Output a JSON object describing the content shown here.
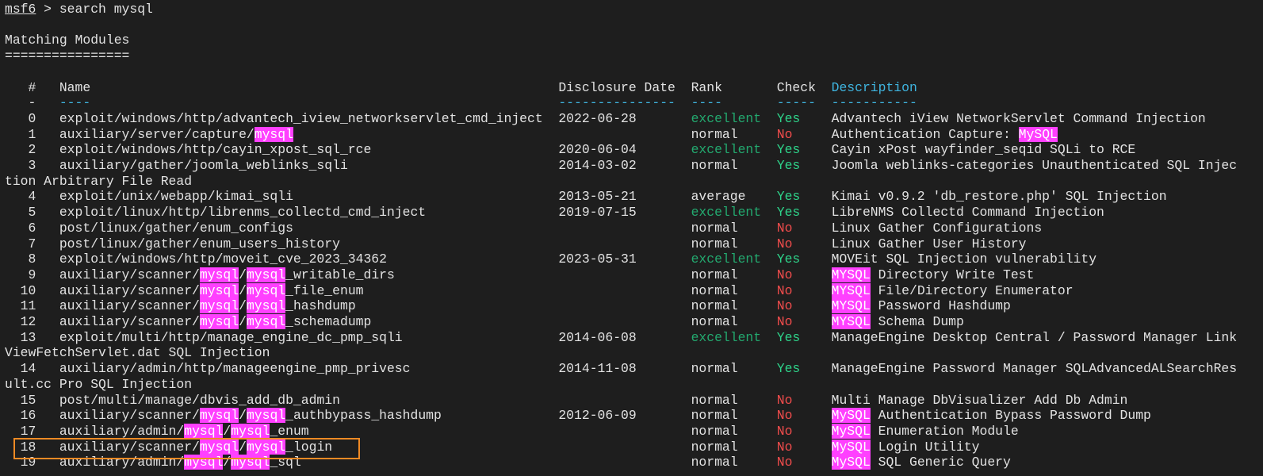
{
  "prompt": {
    "name": "msf6",
    "separator": ">",
    "command": "search mysql"
  },
  "section_title": "Matching Modules",
  "section_underline": "================",
  "highlight_term": "mysql",
  "colors": {
    "background": "#1e1e1e",
    "text": "#e2e2e2",
    "header_accent": "#3fb5e0",
    "highlight": "#ff40ff",
    "excellent": "#23a96f",
    "yes": "#2ed38a",
    "no": "#f14c4c",
    "selection_box": "#f08a24"
  },
  "columns": {
    "num": {
      "label": "#",
      "rule": "-"
    },
    "name": {
      "label": "Name",
      "rule": "----"
    },
    "date": {
      "label": "Disclosure Date",
      "rule": "---------------"
    },
    "rank": {
      "label": "Rank",
      "rule": "----"
    },
    "check": {
      "label": "Check",
      "rule": "-----"
    },
    "description": {
      "label": "Description",
      "rule": "-----------"
    }
  },
  "rows": [
    {
      "num": "0",
      "name": "exploit/windows/http/advantech_iview_networkservlet_cmd_inject",
      "date": "2022-06-28",
      "rank": "excellent",
      "check": "Yes",
      "description": "Advantech iView NetworkServlet Command Injection"
    },
    {
      "num": "1",
      "name": "auxiliary/server/capture/mysql",
      "date": "",
      "rank": "normal",
      "check": "No",
      "description": "Authentication Capture: MySQL"
    },
    {
      "num": "2",
      "name": "exploit/windows/http/cayin_xpost_sql_rce",
      "date": "2020-06-04",
      "rank": "excellent",
      "check": "Yes",
      "description": "Cayin xPost wayfinder_seqid SQLi to RCE"
    },
    {
      "num": "3",
      "name": "auxiliary/gather/joomla_weblinks_sqli",
      "date": "2014-03-02",
      "rank": "normal",
      "check": "Yes",
      "description": "Joomla weblinks-categories Unauthenticated SQL Injection Arbitrary File Read"
    },
    {
      "num": "4",
      "name": "exploit/unix/webapp/kimai_sqli",
      "date": "2013-05-21",
      "rank": "average",
      "check": "Yes",
      "description": "Kimai v0.9.2 'db_restore.php' SQL Injection"
    },
    {
      "num": "5",
      "name": "exploit/linux/http/librenms_collectd_cmd_inject",
      "date": "2019-07-15",
      "rank": "excellent",
      "check": "Yes",
      "description": "LibreNMS Collectd Command Injection"
    },
    {
      "num": "6",
      "name": "post/linux/gather/enum_configs",
      "date": "",
      "rank": "normal",
      "check": "No",
      "description": "Linux Gather Configurations"
    },
    {
      "num": "7",
      "name": "post/linux/gather/enum_users_history",
      "date": "",
      "rank": "normal",
      "check": "No",
      "description": "Linux Gather User History"
    },
    {
      "num": "8",
      "name": "exploit/windows/http/moveit_cve_2023_34362",
      "date": "2023-05-31",
      "rank": "excellent",
      "check": "Yes",
      "description": "MOVEit SQL Injection vulnerability"
    },
    {
      "num": "9",
      "name": "auxiliary/scanner/mysql/mysql_writable_dirs",
      "date": "",
      "rank": "normal",
      "check": "No",
      "description": "MYSQL Directory Write Test"
    },
    {
      "num": "10",
      "name": "auxiliary/scanner/mysql/mysql_file_enum",
      "date": "",
      "rank": "normal",
      "check": "No",
      "description": "MYSQL File/Directory Enumerator"
    },
    {
      "num": "11",
      "name": "auxiliary/scanner/mysql/mysql_hashdump",
      "date": "",
      "rank": "normal",
      "check": "No",
      "description": "MYSQL Password Hashdump"
    },
    {
      "num": "12",
      "name": "auxiliary/scanner/mysql/mysql_schemadump",
      "date": "",
      "rank": "normal",
      "check": "No",
      "description": "MYSQL Schema Dump"
    },
    {
      "num": "13",
      "name": "exploit/multi/http/manage_engine_dc_pmp_sqli",
      "date": "2014-06-08",
      "rank": "excellent",
      "check": "Yes",
      "description": "ManageEngine Desktop Central / Password Manager LinkViewFetchServlet.dat SQL Injection"
    },
    {
      "num": "14",
      "name": "auxiliary/admin/http/manageengine_pmp_privesc",
      "date": "2014-11-08",
      "rank": "normal",
      "check": "Yes",
      "description": "ManageEngine Password Manager SQLAdvancedALSearchResult.cc Pro SQL Injection"
    },
    {
      "num": "15",
      "name": "post/multi/manage/dbvis_add_db_admin",
      "date": "",
      "rank": "normal",
      "check": "No",
      "description": "Multi Manage DbVisualizer Add Db Admin"
    },
    {
      "num": "16",
      "name": "auxiliary/scanner/mysql/mysql_authbypass_hashdump",
      "date": "2012-06-09",
      "rank": "normal",
      "check": "No",
      "description": "MySQL Authentication Bypass Password Dump"
    },
    {
      "num": "17",
      "name": "auxiliary/admin/mysql/mysql_enum",
      "date": "",
      "rank": "normal",
      "check": "No",
      "description": "MySQL Enumeration Module"
    },
    {
      "num": "18",
      "name": "auxiliary/scanner/mysql/mysql_login",
      "date": "",
      "rank": "normal",
      "check": "No",
      "description": "MySQL Login Utility",
      "selected": true
    },
    {
      "num": "19",
      "name": "auxiliary/admin/mysql/mysql_sql",
      "date": "",
      "rank": "normal",
      "check": "No",
      "description": "MySQL SQL Generic Query"
    }
  ]
}
